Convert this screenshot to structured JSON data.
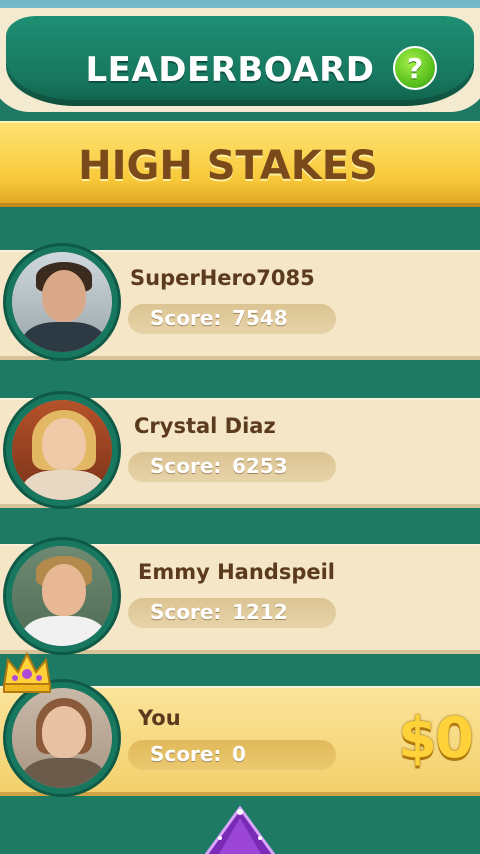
{
  "header": {
    "title": "LEADERBOARD",
    "help_label": "?"
  },
  "subtitle": "HIGH STAKES",
  "score_label": "Score:",
  "rows": [
    {
      "name": "SuperHero7085",
      "score": "7548"
    },
    {
      "name": "Crystal Diaz",
      "score": "6253"
    },
    {
      "name": "Emmy Handspeil",
      "score": "1212"
    },
    {
      "name": "You",
      "score": "0",
      "prize": "$0"
    }
  ],
  "colors": {
    "panel_green": "#17775f",
    "banner_yellow": "#f8c93a",
    "row_cream": "#f4e6c6",
    "text_brown": "#5b3a1e",
    "help_green": "#5cc21f",
    "prize_gold": "#ffd23a"
  },
  "icons": [
    "help-icon",
    "crown-icon",
    "gem-icon"
  ]
}
